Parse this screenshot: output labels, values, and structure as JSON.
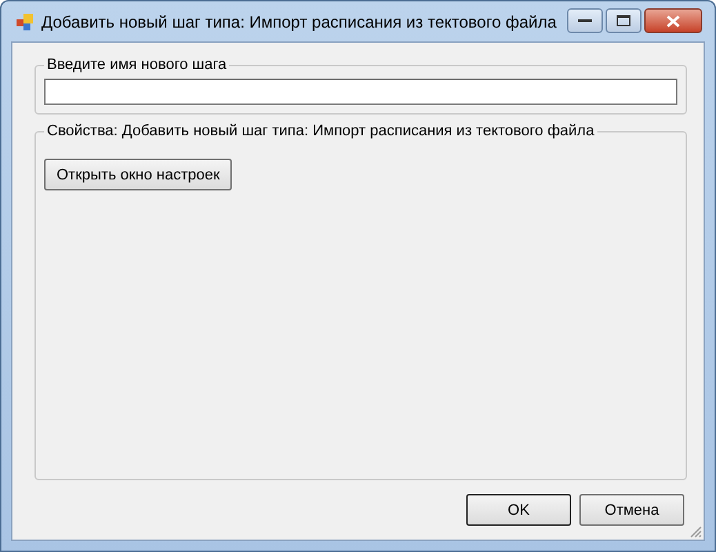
{
  "window": {
    "title": "Добавить новый шаг типа: Импорт расписания из тектового файла"
  },
  "name_group": {
    "label": "Введите имя нового шага"
  },
  "properties_group": {
    "label": "Свойства: Добавить новый шаг типа: Импорт расписания из тектового файла",
    "button": "Открыть окно настроек"
  },
  "buttons": [
    {
      "label": "OK",
      "kind": "default"
    },
    {
      "label": "Отмена",
      "kind": "normal"
    }
  ]
}
